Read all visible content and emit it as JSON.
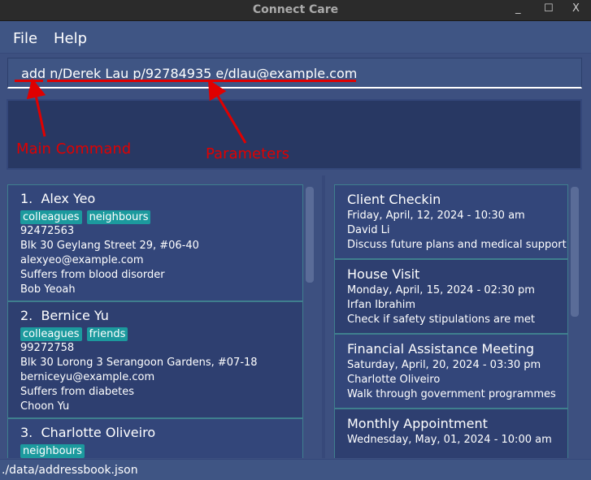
{
  "window": {
    "title": "Connect Care",
    "minimize": "_",
    "maximize": "☐",
    "close": "X"
  },
  "menu": {
    "file": "File",
    "help": "Help"
  },
  "command": {
    "value": " add n/Derek Lau p/92784935 e/dlau@example.com"
  },
  "annotations": {
    "main_command": "Main Command",
    "parameters": "Parameters",
    "color": "#e00000"
  },
  "persons": [
    {
      "index": "1.",
      "name": "Alex Yeo",
      "tags": [
        "colleagues",
        "neighbours"
      ],
      "phone": "92472563",
      "address": "Blk 30 Geylang Street 29, #06-40",
      "email": "alexyeo@example.com",
      "note": "Suffers from blood disorder",
      "contact": "Bob Yeoah"
    },
    {
      "index": "2.",
      "name": "Bernice Yu",
      "tags": [
        "colleagues",
        "friends"
      ],
      "phone": "99272758",
      "address": "Blk 30 Lorong 3 Serangoon Gardens, #07-18",
      "email": "berniceyu@example.com",
      "note": "Suffers from diabetes",
      "contact": "Choon Yu"
    },
    {
      "index": "3.",
      "name": "Charlotte Oliveiro",
      "tags": [
        "neighbours"
      ]
    }
  ],
  "events": [
    {
      "title": "Client Checkin",
      "datetime": "Friday, April, 12, 2024 - 10:30 am",
      "person": "David Li",
      "description": "Discuss future plans and medical support"
    },
    {
      "title": "House Visit",
      "datetime": "Monday, April, 15, 2024 - 02:30 pm",
      "person": "Irfan Ibrahim",
      "description": "Check if safety stipulations are met"
    },
    {
      "title": "Financial Assistance Meeting",
      "datetime": "Saturday, April, 20, 2024 - 03:30 pm",
      "person": "Charlotte Oliveiro",
      "description": "Walk through government programmes"
    },
    {
      "title": "Monthly Appointment",
      "datetime": "Wednesday, May, 01, 2024 - 10:00 am"
    }
  ],
  "status": {
    "path": "./data/addressbook.json"
  },
  "colors": {
    "background": "#3d5080",
    "card": "#33467a",
    "tag": "#1c9a9e",
    "result_box": "#283863"
  }
}
